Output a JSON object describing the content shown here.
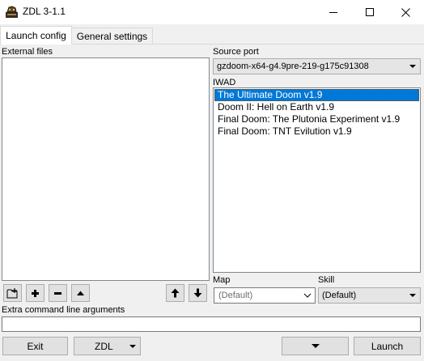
{
  "window": {
    "title": "ZDL 3-1.1",
    "icon": "zdl-app-icon",
    "controls": [
      "minimize",
      "maximize",
      "close"
    ]
  },
  "tabs": [
    {
      "label": "Launch config",
      "active": true
    },
    {
      "label": "General settings",
      "active": false
    }
  ],
  "external_files": {
    "label": "External files",
    "items": []
  },
  "source_port": {
    "label": "Source port",
    "selected": "gzdoom-x64-g4.9pre-219-g175c91308"
  },
  "iwad": {
    "label": "IWAD",
    "items": [
      {
        "label": "The Ultimate Doom v1.9",
        "selected": true
      },
      {
        "label": "Doom II: Hell on Earth v1.9",
        "selected": false
      },
      {
        "label": "Final Doom: The Plutonia Experiment v1.9",
        "selected": false
      },
      {
        "label": "Final Doom: TNT Evilution v1.9",
        "selected": false
      }
    ]
  },
  "map": {
    "label": "Map",
    "placeholder": "(Default)"
  },
  "skill": {
    "label": "Skill",
    "selected": "(Default)"
  },
  "file_toolbar": {
    "icons": [
      "add-folder-icon",
      "add-icon",
      "remove-icon",
      "collapse-up-icon",
      "move-up-icon",
      "move-down-icon"
    ]
  },
  "extra_args": {
    "label": "Extra command line arguments",
    "value": ""
  },
  "bottom_bar": {
    "exit_label": "Exit",
    "zdl_label": "ZDL",
    "launch_label": "Launch"
  }
}
